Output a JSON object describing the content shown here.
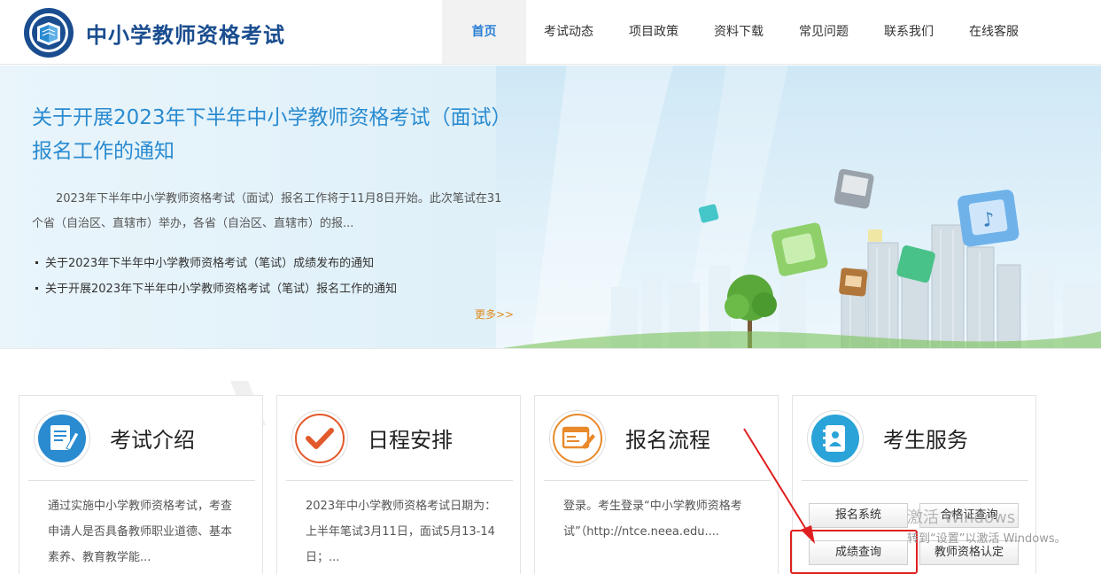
{
  "site": {
    "title": "中小学教师资格考试"
  },
  "nav": {
    "items": [
      {
        "label": "首页",
        "active": true
      },
      {
        "label": "考试动态"
      },
      {
        "label": "项目政策"
      },
      {
        "label": "资料下载"
      },
      {
        "label": "常见问题"
      },
      {
        "label": "联系我们"
      },
      {
        "label": "在线客服"
      }
    ]
  },
  "banner": {
    "headline": "关于开展2023年下半年中小学教师资格考试（面试）报名工作的通知",
    "summary": "2023年下半年中小学教师资格考试（面试）报名工作将于11月8日开始。此次笔试在31个省（自治区、直辖市）举办，各省（自治区、直辖市）的报...",
    "links": [
      "关于2023年下半年中小学教师资格考试（笔试）成绩发布的通知",
      "关于开展2023年下半年中小学教师资格考试（笔试）报名工作的通知"
    ],
    "more": "更多>>"
  },
  "cards": [
    {
      "title": "考试介绍",
      "icon": "document-pen-icon",
      "body": "通过实施中小学教师资格考试，考查申请人是否具备教师职业道德、基本素养、教育教学能..."
    },
    {
      "title": "日程安排",
      "icon": "checkmark-icon",
      "body": "2023年中小学教师资格考试日期为：上半年笔试3月11日，面试5月13-14日；..."
    },
    {
      "title": "报名流程",
      "icon": "form-pen-icon",
      "body": "登录。考生登录“中小学教师资格考试”（http://ntce.neea.edu...."
    },
    {
      "title": "考生服务",
      "icon": "address-book-icon",
      "buttons": [
        "报名系统",
        "合格证查询",
        "成绩查询",
        "教师资格认定"
      ]
    }
  ],
  "watermark": {
    "line1": "激活 Windows",
    "line2": "转到“设置”以激活 Windows。"
  },
  "colors": {
    "accent": "#2a8bd0",
    "brand": "#1a4d8f",
    "highlight": "#e02020",
    "more": "#e08a1a",
    "card_icon": "#2a8bd0",
    "check_icon": "#e2592b",
    "form_icon": "#e8892a"
  }
}
